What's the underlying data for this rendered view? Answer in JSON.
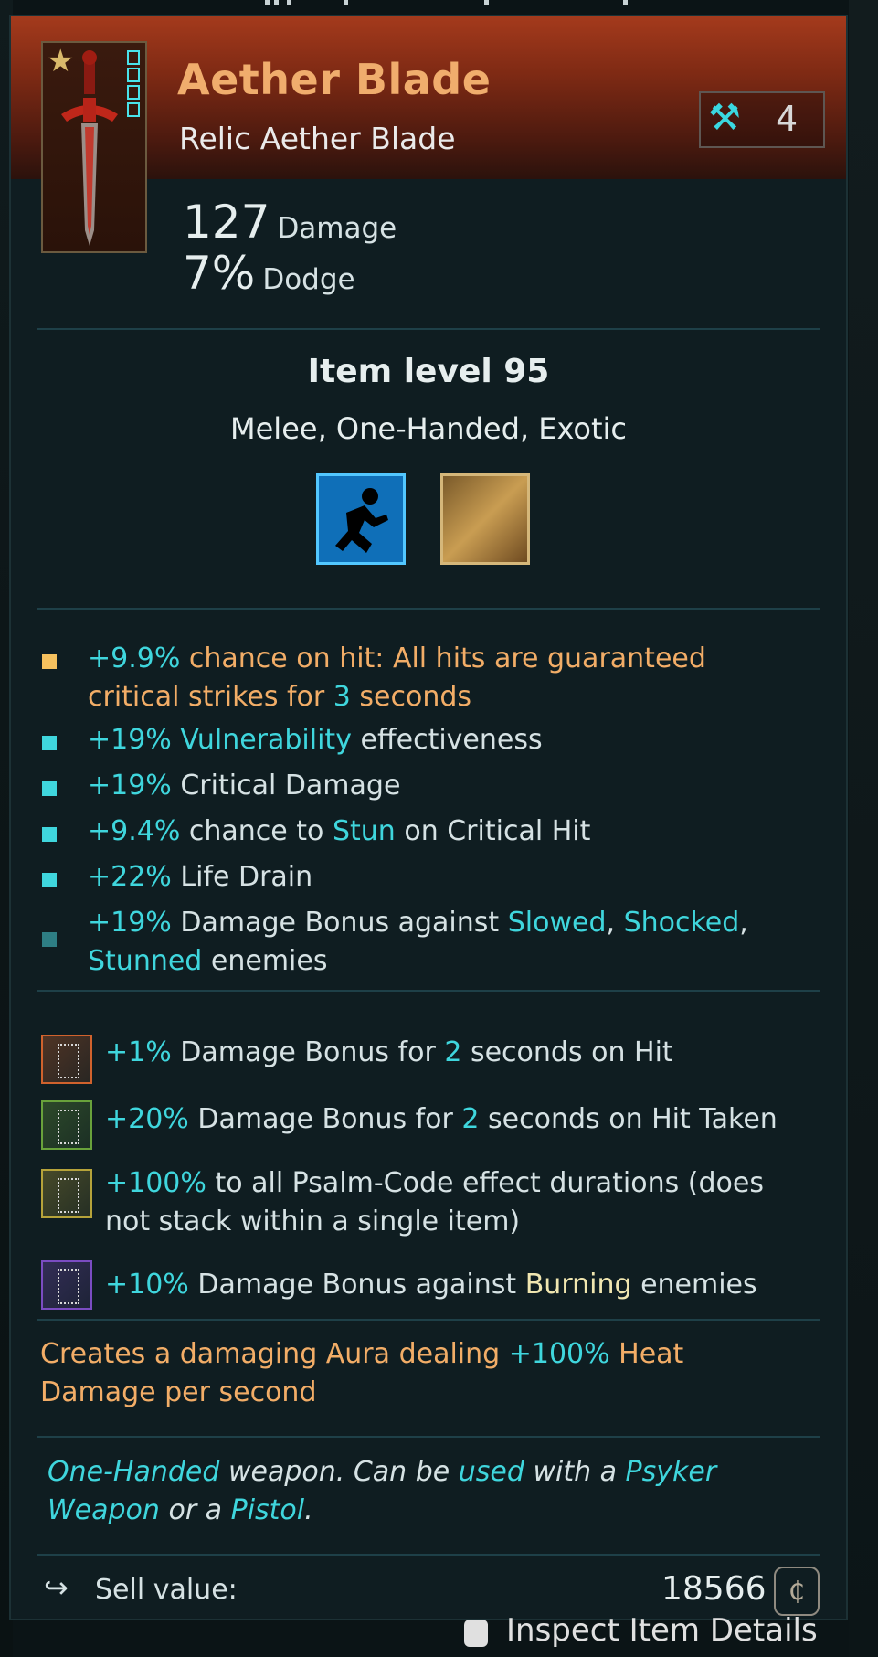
{
  "item": {
    "name": "Aether Blade",
    "subtitle": "Relic Aether Blade",
    "upgrade_level": "4",
    "stats": [
      {
        "value": "127",
        "label": "Damage"
      },
      {
        "value": "7%",
        "label": "Dodge"
      }
    ],
    "item_level": "Item level 95",
    "tags": "Melee, One-Handed, Exotic",
    "perk_icons": [
      "running-figure-icon",
      "burning-tome-icon"
    ]
  },
  "affixes": [
    {
      "bullet_color": "#f6c15e",
      "parts": [
        {
          "t": "+9.9%",
          "c": "cyan"
        },
        {
          "t": " chance on hit: All hits are guaranteed",
          "c": "orange"
        }
      ],
      "line2": [
        {
          "t": "critical strikes for ",
          "c": "orange"
        },
        {
          "t": "3",
          "c": "cyan"
        },
        {
          "t": " seconds",
          "c": "orange"
        }
      ]
    },
    {
      "bullet_color": "#3fd6dd",
      "parts": [
        {
          "t": "+19%",
          "c": "cyan"
        },
        {
          "t": " Vulnerability",
          "c": "cyan"
        },
        {
          "t": " effectiveness",
          "c": "plain"
        }
      ]
    },
    {
      "bullet_color": "#3fd6dd",
      "parts": [
        {
          "t": "+19%",
          "c": "cyan"
        },
        {
          "t": " Critical Damage",
          "c": "plain"
        }
      ]
    },
    {
      "bullet_color": "#3fd6dd",
      "parts": [
        {
          "t": "+9.4%",
          "c": "cyan"
        },
        {
          "t": " chance to ",
          "c": "plain"
        },
        {
          "t": "Stun",
          "c": "cyan"
        },
        {
          "t": " on Critical Hit",
          "c": "plain"
        }
      ]
    },
    {
      "bullet_color": "#3fd6dd",
      "parts": [
        {
          "t": "+22%",
          "c": "cyan"
        },
        {
          "t": " Life Drain",
          "c": "plain"
        }
      ]
    },
    {
      "bullet_color": "#2e7e84",
      "parts": [
        {
          "t": "+19%",
          "c": "cyan"
        },
        {
          "t": " Damage Bonus against ",
          "c": "plain"
        },
        {
          "t": "Slowed",
          "c": "cyan"
        },
        {
          "t": ", ",
          "c": "plain"
        },
        {
          "t": "Shocked",
          "c": "cyan"
        },
        {
          "t": ",",
          "c": "plain"
        }
      ],
      "line2": [
        {
          "t": "Stunned",
          "c": "cyan"
        },
        {
          "t": " enemies",
          "c": "plain"
        }
      ]
    }
  ],
  "psalm_codes": [
    {
      "color": "#d0622d",
      "parts": [
        {
          "t": "+1%",
          "c": "cyan"
        },
        {
          "t": " Damage Bonus for ",
          "c": "plain"
        },
        {
          "t": "2",
          "c": "cyan"
        },
        {
          "t": " seconds on Hit",
          "c": "plain"
        }
      ]
    },
    {
      "color": "#69a23b",
      "parts": [
        {
          "t": "+20%",
          "c": "cyan"
        },
        {
          "t": " Damage Bonus for ",
          "c": "plain"
        },
        {
          "t": "2",
          "c": "cyan"
        },
        {
          "t": " seconds on Hit Taken",
          "c": "plain"
        }
      ]
    },
    {
      "color": "#b6a33a",
      "parts": [
        {
          "t": "+100%",
          "c": "cyan"
        },
        {
          "t": " to all Psalm-Code effect durations (does",
          "c": "plain"
        }
      ],
      "line2": [
        {
          "t": "not stack within a single item)",
          "c": "plain"
        }
      ]
    },
    {
      "color": "#7b4cc2",
      "parts": [
        {
          "t": "+10%",
          "c": "cyan"
        },
        {
          "t": " Damage Bonus against ",
          "c": "plain"
        },
        {
          "t": "Burning",
          "c": "yellow"
        },
        {
          "t": " enemies",
          "c": "plain"
        }
      ]
    }
  ],
  "aura": {
    "line1": [
      {
        "t": "Creates a damaging Aura dealing ",
        "c": "orange"
      },
      {
        "t": "+100%",
        "c": "cyan"
      },
      {
        "t": " Heat",
        "c": "orange"
      }
    ],
    "line2": [
      {
        "t": "Damage per second",
        "c": "orange"
      }
    ]
  },
  "flavor": {
    "line1": [
      {
        "t": "One-Handed",
        "c": "cyan"
      },
      {
        "t": " weapon. Can be ",
        "c": "plain"
      },
      {
        "t": "used",
        "c": "cyan"
      },
      {
        "t": " with a ",
        "c": "plain"
      },
      {
        "t": "Psyker",
        "c": "cyan"
      }
    ],
    "line2": [
      {
        "t": "Weapon",
        "c": "cyan"
      },
      {
        "t": " or a ",
        "c": "plain"
      },
      {
        "t": "Pistol",
        "c": "cyan"
      },
      {
        "t": ".",
        "c": "plain"
      }
    ]
  },
  "sell": {
    "label": "Sell value:",
    "value": "18566",
    "currency_icon": "credits-icon"
  },
  "footer_hint": "Inspect Item Details"
}
